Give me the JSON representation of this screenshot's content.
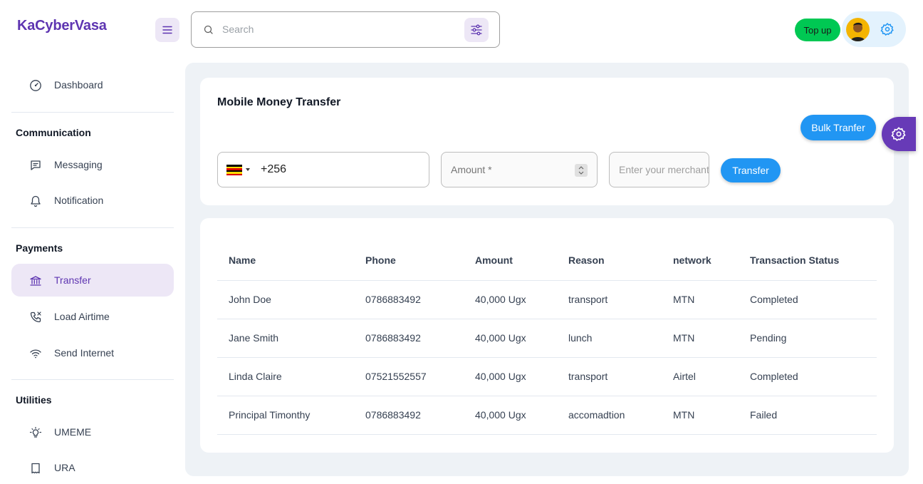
{
  "brand": "KaCyberVasa",
  "search": {
    "placeholder": "Search"
  },
  "header": {
    "topup_label": "Top up"
  },
  "sidebar": {
    "dashboard": "Dashboard",
    "sections": {
      "communication": "Communication",
      "payments": "Payments",
      "utilities": "Utilities"
    },
    "items": {
      "messaging": "Messaging",
      "notification": "Notification",
      "transfer": "Transfer",
      "load_airtime": "Load Airtime",
      "send_internet": "Send Internet",
      "umeme": "UMEME",
      "ura": "URA"
    }
  },
  "transfer_form": {
    "title": "Mobile Money Transfer",
    "bulk_label": "Bulk Tranfer",
    "phone_value": "+256",
    "amount_placeholder": "Amount *",
    "merchant_placeholder": "Enter your merchant",
    "submit_label": "Transfer"
  },
  "table": {
    "headers": [
      "Name",
      "Phone",
      "Amount",
      "Reason",
      "network",
      "Transaction Status"
    ],
    "rows": [
      [
        "John Doe",
        "0786883492",
        "40,000 Ugx",
        "transport",
        "MTN",
        "Completed"
      ],
      [
        "Jane Smith",
        "0786883492",
        "40,000 Ugx",
        "lunch",
        "MTN",
        "Pending"
      ],
      [
        "Linda Claire",
        "07521552557",
        "40,000 Ugx",
        "transport",
        "Airtel",
        "Completed"
      ],
      [
        "Principal Timonthy",
        "0786883492",
        "40,000 Ugx",
        "accomadtion",
        "MTN",
        "Failed"
      ]
    ]
  },
  "colors": {
    "accent": "#5e35b1",
    "primary": "#2196f3",
    "success": "#00c853"
  }
}
